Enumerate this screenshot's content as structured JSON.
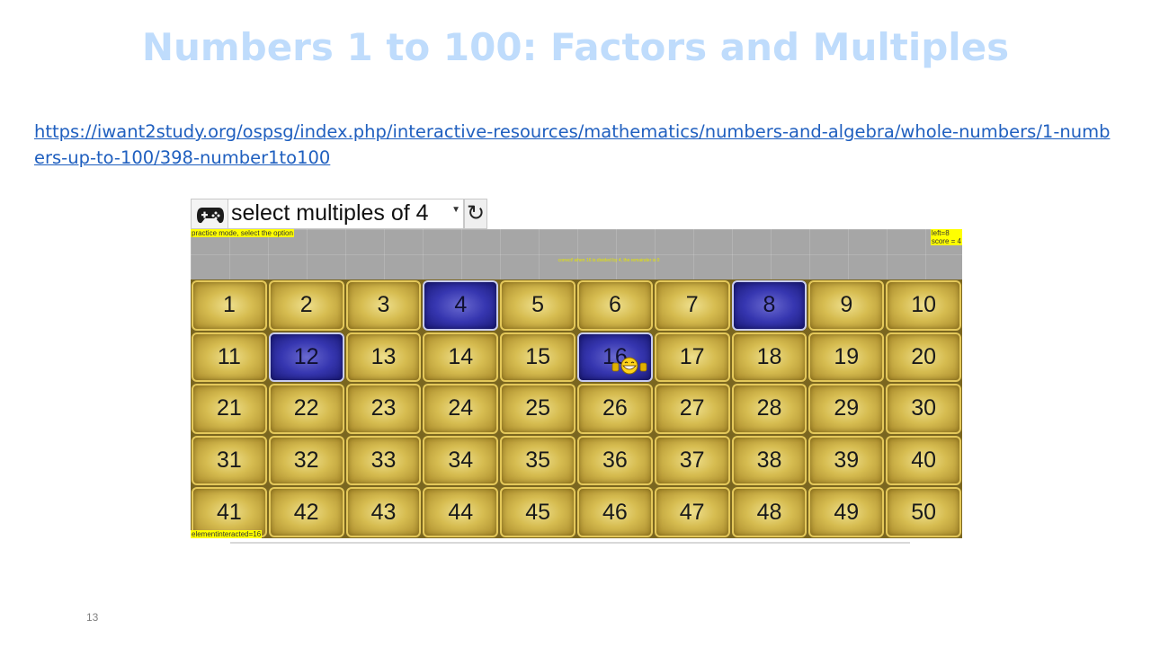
{
  "slide": {
    "title": "Numbers 1 to 100: Factors and Multiples",
    "link": "https://iwant2study.org/ospsg/index.php/interactive-resources/mathematics/numbers-and-algebra/whole-numbers/1-numbers-up-to-100/398-number1to100",
    "page_number": "13"
  },
  "toolbar": {
    "gamepad_icon": "gamepad-icon",
    "select_value": "select multiples of 4",
    "refresh_icon": "refresh-icon",
    "refresh_glyph": "↻"
  },
  "status": {
    "mode_text": "practice mode, select the option",
    "left_text": "left=8",
    "score_text": "score = 4",
    "feedback_text": "correct! when 16 is divided by 4, the remainder is 0",
    "element_interacted": "elementinteracted=16"
  },
  "grid": {
    "tiles": [
      {
        "n": "1",
        "selected": false
      },
      {
        "n": "2",
        "selected": false
      },
      {
        "n": "3",
        "selected": false
      },
      {
        "n": "4",
        "selected": true
      },
      {
        "n": "5",
        "selected": false
      },
      {
        "n": "6",
        "selected": false
      },
      {
        "n": "7",
        "selected": false
      },
      {
        "n": "8",
        "selected": true
      },
      {
        "n": "9",
        "selected": false
      },
      {
        "n": "10",
        "selected": false
      },
      {
        "n": "11",
        "selected": false
      },
      {
        "n": "12",
        "selected": true
      },
      {
        "n": "13",
        "selected": false
      },
      {
        "n": "14",
        "selected": false
      },
      {
        "n": "15",
        "selected": false
      },
      {
        "n": "16",
        "selected": true,
        "emoji": true
      },
      {
        "n": "17",
        "selected": false
      },
      {
        "n": "18",
        "selected": false
      },
      {
        "n": "19",
        "selected": false
      },
      {
        "n": "20",
        "selected": false
      },
      {
        "n": "21",
        "selected": false
      },
      {
        "n": "22",
        "selected": false
      },
      {
        "n": "23",
        "selected": false
      },
      {
        "n": "24",
        "selected": false
      },
      {
        "n": "25",
        "selected": false
      },
      {
        "n": "26",
        "selected": false
      },
      {
        "n": "27",
        "selected": false
      },
      {
        "n": "28",
        "selected": false
      },
      {
        "n": "29",
        "selected": false
      },
      {
        "n": "30",
        "selected": false
      },
      {
        "n": "31",
        "selected": false
      },
      {
        "n": "32",
        "selected": false
      },
      {
        "n": "33",
        "selected": false
      },
      {
        "n": "34",
        "selected": false
      },
      {
        "n": "35",
        "selected": false
      },
      {
        "n": "36",
        "selected": false
      },
      {
        "n": "37",
        "selected": false
      },
      {
        "n": "38",
        "selected": false
      },
      {
        "n": "39",
        "selected": false
      },
      {
        "n": "40",
        "selected": false
      },
      {
        "n": "41",
        "selected": false
      },
      {
        "n": "42",
        "selected": false
      },
      {
        "n": "43",
        "selected": false
      },
      {
        "n": "44",
        "selected": false
      },
      {
        "n": "45",
        "selected": false
      },
      {
        "n": "46",
        "selected": false
      },
      {
        "n": "47",
        "selected": false
      },
      {
        "n": "48",
        "selected": false
      },
      {
        "n": "49",
        "selected": false
      },
      {
        "n": "50",
        "selected": false
      }
    ]
  },
  "colors": {
    "title": "#bfdcfc",
    "link": "#1f5fbf",
    "tile_gold": "#d6bc50",
    "tile_selected": "#3636b0",
    "status_bg": "#a6a6a6",
    "tag_bg": "#ffff00"
  }
}
